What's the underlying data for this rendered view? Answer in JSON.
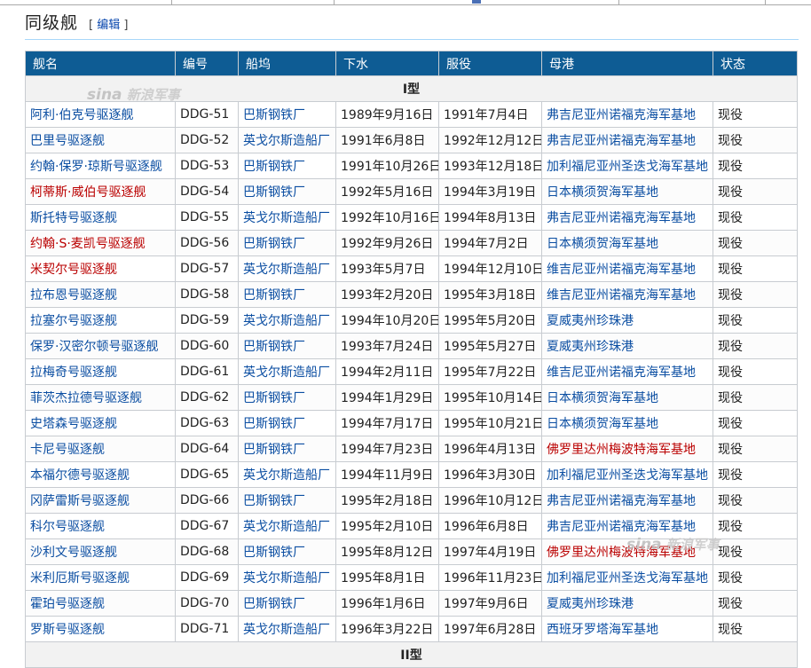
{
  "section": {
    "title": "同级舰",
    "edit_open": "[",
    "edit_label": "编辑",
    "edit_close": "]"
  },
  "table": {
    "headers": [
      "舰名",
      "编号",
      "船坞",
      "下水",
      "服役",
      "母港",
      "状态"
    ],
    "group_label": "I型",
    "next_group_label": "II型",
    "rows": [
      {
        "name": "阿利·伯克号驱逐舰",
        "name_red": false,
        "hull": "DDG-51",
        "yard": "巴斯钢铁厂",
        "launched": "1989年9月16日",
        "commissioned": "1991年7月4日",
        "port": "弗吉尼亚州诺福克海军基地",
        "port_red": false,
        "status": "现役"
      },
      {
        "name": "巴里号驱逐舰",
        "name_red": false,
        "hull": "DDG-52",
        "yard": "英戈尔斯造船厂",
        "launched": "1991年6月8日",
        "commissioned": "1992年12月12日",
        "port": "弗吉尼亚州诺福克海军基地",
        "port_red": false,
        "status": "现役"
      },
      {
        "name": "约翰·保罗·琼斯号驱逐舰",
        "name_red": false,
        "hull": "DDG-53",
        "yard": "巴斯钢铁厂",
        "launched": "1991年10月26日",
        "commissioned": "1993年12月18日",
        "port": "加利福尼亚州圣迭戈海军基地",
        "port_red": false,
        "status": "现役"
      },
      {
        "name": "柯蒂斯·威伯号驱逐舰",
        "name_red": true,
        "hull": "DDG-54",
        "yard": "巴斯钢铁厂",
        "launched": "1992年5月16日",
        "commissioned": "1994年3月19日",
        "port": "日本横须贺海军基地",
        "port_red": false,
        "status": "现役"
      },
      {
        "name": "斯托特号驱逐舰",
        "name_red": false,
        "hull": "DDG-55",
        "yard": "英戈尔斯造船厂",
        "launched": "1992年10月16日",
        "commissioned": "1994年8月13日",
        "port": "弗吉尼亚州诺福克海军基地",
        "port_red": false,
        "status": "现役"
      },
      {
        "name": "约翰·S·麦凯号驱逐舰",
        "name_red": true,
        "hull": "DDG-56",
        "yard": "巴斯钢铁厂",
        "launched": "1992年9月26日",
        "commissioned": "1994年7月2日",
        "port": "日本横须贺海军基地",
        "port_red": false,
        "status": "现役"
      },
      {
        "name": "米契尔号驱逐舰",
        "name_red": true,
        "hull": "DDG-57",
        "yard": "英戈尔斯造船厂",
        "launched": "1993年5月7日",
        "commissioned": "1994年12月10日",
        "port": "维吉尼亚州诺福克海军基地",
        "port_red": false,
        "status": "现役"
      },
      {
        "name": "拉布恩号驱逐舰",
        "name_red": false,
        "hull": "DDG-58",
        "yard": "巴斯钢铁厂",
        "launched": "1993年2月20日",
        "commissioned": "1995年3月18日",
        "port": "维吉尼亚州诺福克海军基地",
        "port_red": false,
        "status": "现役"
      },
      {
        "name": "拉塞尔号驱逐舰",
        "name_red": false,
        "hull": "DDG-59",
        "yard": "英戈尔斯造船厂",
        "launched": "1994年10月20日",
        "commissioned": "1995年5月20日",
        "port": "夏威夷州珍珠港",
        "port_red": false,
        "status": "现役"
      },
      {
        "name": "保罗·汉密尔顿号驱逐舰",
        "name_red": false,
        "hull": "DDG-60",
        "yard": "巴斯钢铁厂",
        "launched": "1993年7月24日",
        "commissioned": "1995年5月27日",
        "port": "夏威夷州珍珠港",
        "port_red": false,
        "status": "现役"
      },
      {
        "name": "拉梅奇号驱逐舰",
        "name_red": false,
        "hull": "DDG-61",
        "yard": "英戈尔斯造船厂",
        "launched": "1994年2月11日",
        "commissioned": "1995年7月22日",
        "port": "维吉尼亚州诺福克海军基地",
        "port_red": false,
        "status": "现役"
      },
      {
        "name": "菲茨杰拉德号驱逐舰",
        "name_red": false,
        "hull": "DDG-62",
        "yard": "巴斯钢铁厂",
        "launched": "1994年1月29日",
        "commissioned": "1995年10月14日",
        "port": "日本横须贺海军基地",
        "port_red": false,
        "status": "现役"
      },
      {
        "name": "史塔森号驱逐舰",
        "name_red": false,
        "hull": "DDG-63",
        "yard": "巴斯钢铁厂",
        "launched": "1994年7月17日",
        "commissioned": "1995年10月21日",
        "port": "日本横须贺海军基地",
        "port_red": false,
        "status": "现役"
      },
      {
        "name": "卡尼号驱逐舰",
        "name_red": false,
        "hull": "DDG-64",
        "yard": "巴斯钢铁厂",
        "launched": "1994年7月23日",
        "commissioned": "1996年4月13日",
        "port": "佛罗里达州梅波特海军基地",
        "port_red": true,
        "status": "现役"
      },
      {
        "name": "本福尔德号驱逐舰",
        "name_red": false,
        "hull": "DDG-65",
        "yard": "英戈尔斯造船厂",
        "launched": "1994年11月9日",
        "commissioned": "1996年3月30日",
        "port": "加利福尼亚州圣迭戈海军基地",
        "port_red": false,
        "status": "现役"
      },
      {
        "name": "冈萨雷斯号驱逐舰",
        "name_red": false,
        "hull": "DDG-66",
        "yard": "巴斯钢铁厂",
        "launched": "1995年2月18日",
        "commissioned": "1996年10月12日",
        "port": "弗吉尼亚州诺福克海军基地",
        "port_red": false,
        "status": "现役"
      },
      {
        "name": "科尔号驱逐舰",
        "name_red": false,
        "hull": "DDG-67",
        "yard": "英戈尔斯造船厂",
        "launched": "1995年2月10日",
        "commissioned": "1996年6月8日",
        "port": "弗吉尼亚州诺福克海军基地",
        "port_red": false,
        "status": "现役"
      },
      {
        "name": "沙利文号驱逐舰",
        "name_red": false,
        "hull": "DDG-68",
        "yard": "巴斯钢铁厂",
        "launched": "1995年8月12日",
        "commissioned": "1997年4月19日",
        "port": "佛罗里达州梅波特海军基地",
        "port_red": true,
        "status": "现役"
      },
      {
        "name": "米利厄斯号驱逐舰",
        "name_red": false,
        "hull": "DDG-69",
        "yard": "英戈尔斯造船厂",
        "launched": "1995年8月1日",
        "commissioned": "1996年11月23日",
        "port": "加利福尼亚州圣迭戈海军基地",
        "port_red": false,
        "status": "现役"
      },
      {
        "name": "霍珀号驱逐舰",
        "name_red": false,
        "hull": "DDG-70",
        "yard": "巴斯钢铁厂",
        "launched": "1996年1月6日",
        "commissioned": "1997年9月6日",
        "port": "夏威夷州珍珠港",
        "port_red": false,
        "status": "现役"
      },
      {
        "name": "罗斯号驱逐舰",
        "name_red": false,
        "hull": "DDG-71",
        "yard": "英戈尔斯造船厂",
        "launched": "1996年3月22日",
        "commissioned": "1997年6月28日",
        "port": "西班牙罗塔海军基地",
        "port_red": false,
        "status": "现役"
      }
    ]
  },
  "watermarks": {
    "logo": "sina",
    "text": "新浪军事"
  },
  "colors": {
    "header_bg": "#0e5c94",
    "link": "#0b4ea2",
    "redlink": "#ba0000"
  }
}
